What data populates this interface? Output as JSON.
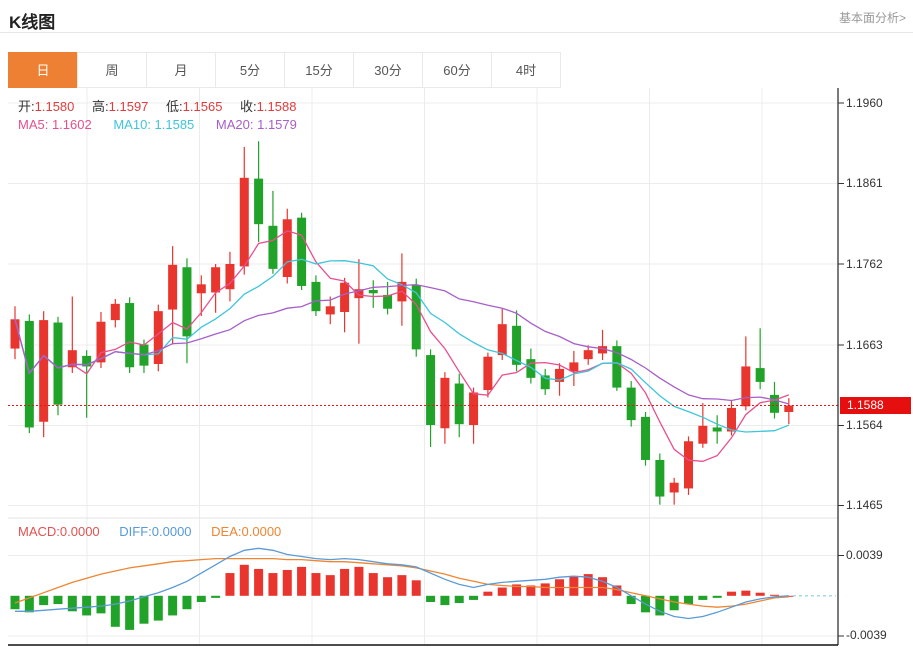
{
  "header": {
    "title": "K线图",
    "link": "基本面分析>"
  },
  "tabs": [
    {
      "label": "日",
      "active": true
    },
    {
      "label": "周",
      "active": false
    },
    {
      "label": "月",
      "active": false
    },
    {
      "label": "5分",
      "active": false
    },
    {
      "label": "15分",
      "active": false
    },
    {
      "label": "30分",
      "active": false
    },
    {
      "label": "60分",
      "active": false
    },
    {
      "label": "4时",
      "active": false
    }
  ],
  "ohlc_legend": [
    {
      "label": "开:",
      "value": "1.1580"
    },
    {
      "label": "高:",
      "value": "1.1597"
    },
    {
      "label": "低:",
      "value": "1.1565"
    },
    {
      "label": "收:",
      "value": "1.1588"
    }
  ],
  "ma_legend": {
    "ma5": "MA5: 1.1602",
    "ma10": "MA10: 1.1585",
    "ma20": "MA20: 1.1579"
  },
  "macd_legend": {
    "macd": "MACD:0.0000",
    "diff": "DIFF:0.0000",
    "dea": "DEA:0.0000"
  },
  "price_tag": "1.1588",
  "colors": {
    "up": "#e8352e",
    "down": "#21a32a",
    "ma5": "#e84f8f",
    "ma10": "#3fc5da",
    "ma20": "#a75fc9",
    "diff": "#5b9bd5",
    "dea": "#ef8532",
    "price_line": "#e81717",
    "tag_bg": "#e50f0f",
    "tab_active": "#ee8033",
    "zero_dash": "#85cfe0",
    "grid": "#ececec",
    "axis": "#333333"
  },
  "chart_data": {
    "type": "candlestick",
    "period": "日",
    "main_ylabels": [
      "1.1960",
      "1.1861",
      "1.1762",
      "1.1663",
      "1.1564",
      "1.1465"
    ],
    "macd_ylabels": [
      "0.0039",
      "-0.0039"
    ],
    "y_top": 1.196,
    "y_bottom": 1.1465,
    "current_price": 1.1588,
    "last_ohlc": {
      "open": 1.158,
      "high": 1.1597,
      "low": 1.1565,
      "close": 1.1588
    },
    "ma_values": {
      "MA5": 1.1602,
      "MA10": 1.1585,
      "MA20": 1.1579
    },
    "candles_format": [
      "open",
      "high",
      "low",
      "close"
    ],
    "candles": [
      [
        1.1658,
        1.171,
        1.1645,
        1.1694
      ],
      [
        1.1692,
        1.17,
        1.1554,
        1.1561
      ],
      [
        1.1568,
        1.1704,
        1.1549,
        1.1693
      ],
      [
        1.169,
        1.1697,
        1.1576,
        1.1589
      ],
      [
        1.1635,
        1.1722,
        1.1628,
        1.1656
      ],
      [
        1.1649,
        1.1656,
        1.1573,
        1.1636
      ],
      [
        1.1641,
        1.1703,
        1.1634,
        1.1691
      ],
      [
        1.1693,
        1.1719,
        1.1684,
        1.1713
      ],
      [
        1.1714,
        1.1721,
        1.1628,
        1.1635
      ],
      [
        1.1663,
        1.1669,
        1.1628,
        1.1637
      ],
      [
        1.1639,
        1.1712,
        1.163,
        1.1704
      ],
      [
        1.1706,
        1.1784,
        1.1663,
        1.1761
      ],
      [
        1.1758,
        1.1769,
        1.164,
        1.1673
      ],
      [
        1.1726,
        1.1748,
        1.1698,
        1.1737
      ],
      [
        1.1727,
        1.1762,
        1.1702,
        1.1758
      ],
      [
        1.1731,
        1.1777,
        1.1716,
        1.1762
      ],
      [
        1.1759,
        1.1906,
        1.1749,
        1.1868
      ],
      [
        1.1867,
        1.1913,
        1.1789,
        1.1811
      ],
      [
        1.1809,
        1.1852,
        1.175,
        1.1756
      ],
      [
        1.1746,
        1.183,
        1.1738,
        1.1817
      ],
      [
        1.1819,
        1.1825,
        1.173,
        1.1735
      ],
      [
        1.174,
        1.1748,
        1.1698,
        1.1704
      ],
      [
        1.17,
        1.1722,
        1.1688,
        1.171
      ],
      [
        1.1703,
        1.1745,
        1.1678,
        1.1739
      ],
      [
        1.172,
        1.1768,
        1.1664,
        1.1731
      ],
      [
        1.173,
        1.1742,
        1.1708,
        1.1726
      ],
      [
        1.1724,
        1.174,
        1.17,
        1.1707
      ],
      [
        1.1716,
        1.1775,
        1.1686,
        1.174
      ],
      [
        1.1736,
        1.1744,
        1.1648,
        1.1657
      ],
      [
        1.165,
        1.1657,
        1.1537,
        1.1564
      ],
      [
        1.156,
        1.1629,
        1.1541,
        1.1622
      ],
      [
        1.1615,
        1.1627,
        1.1549,
        1.1565
      ],
      [
        1.1564,
        1.161,
        1.1541,
        1.1604
      ],
      [
        1.1607,
        1.1653,
        1.1598,
        1.1648
      ],
      [
        1.165,
        1.1707,
        1.1644,
        1.1688
      ],
      [
        1.1686,
        1.1705,
        1.163,
        1.1638
      ],
      [
        1.1645,
        1.1658,
        1.1615,
        1.1622
      ],
      [
        1.1625,
        1.1633,
        1.1601,
        1.1608
      ],
      [
        1.1617,
        1.164,
        1.16,
        1.1633
      ],
      [
        1.163,
        1.1655,
        1.1612,
        1.1641
      ],
      [
        1.1645,
        1.1662,
        1.1638,
        1.1656
      ],
      [
        1.1652,
        1.1681,
        1.1644,
        1.1661
      ],
      [
        1.1661,
        1.1668,
        1.1606,
        1.161
      ],
      [
        1.161,
        1.1618,
        1.1562,
        1.157
      ],
      [
        1.1574,
        1.158,
        1.1514,
        1.1521
      ],
      [
        1.1521,
        1.1529,
        1.1466,
        1.1476
      ],
      [
        1.1481,
        1.1499,
        1.1466,
        1.1493
      ],
      [
        1.1486,
        1.155,
        1.1478,
        1.1544
      ],
      [
        1.1541,
        1.1591,
        1.1536,
        1.1563
      ],
      [
        1.1561,
        1.1576,
        1.1541,
        1.1556
      ],
      [
        1.1556,
        1.1594,
        1.1551,
        1.1585
      ],
      [
        1.1587,
        1.1673,
        1.1582,
        1.1636
      ],
      [
        1.1634,
        1.1683,
        1.1608,
        1.1617
      ],
      [
        1.1601,
        1.1617,
        1.1572,
        1.1579
      ],
      [
        1.158,
        1.1597,
        1.1565,
        1.1588
      ]
    ],
    "ma_periods": [
      5,
      10,
      20
    ],
    "macd": {
      "unit": 0.0001,
      "zero": 0.0,
      "hist": [
        -13,
        -16,
        -9,
        -8,
        -15,
        -19,
        -17,
        -30,
        -33,
        -27,
        -24,
        -19,
        -13,
        -6,
        -2,
        22,
        30,
        26,
        22,
        25,
        28,
        22,
        20,
        26,
        28,
        22,
        18,
        20,
        15,
        -6,
        -9,
        -7,
        -4,
        4,
        8,
        11,
        10,
        12,
        16,
        19,
        21,
        18,
        10,
        -8,
        -16,
        -19,
        -14,
        -8,
        -4,
        -2,
        4,
        5,
        3,
        1,
        0
      ],
      "dif": [
        -15,
        -15,
        -14,
        -13,
        -12,
        -11,
        -10,
        -8,
        -5,
        -1,
        3,
        8,
        14,
        22,
        30,
        38,
        44,
        46,
        44,
        40,
        38,
        36,
        35,
        36,
        35,
        33,
        31,
        30,
        28,
        22,
        16,
        11,
        8,
        11,
        13,
        14,
        15,
        16,
        18,
        19,
        18,
        14,
        8,
        0,
        -8,
        -15,
        -20,
        -22,
        -20,
        -16,
        -11,
        -6,
        -3,
        -1,
        0
      ],
      "dea": [
        -7,
        -2,
        3,
        8,
        13,
        17,
        21,
        24,
        27,
        29,
        31,
        33,
        34,
        35,
        36,
        36,
        36,
        36,
        36,
        35,
        35,
        34,
        33,
        33,
        32,
        31,
        30,
        29,
        27,
        24,
        21,
        17,
        14,
        11,
        10,
        9,
        9,
        8,
        8,
        8,
        8,
        8,
        6,
        3,
        0,
        -3,
        -6,
        -8,
        -10,
        -11,
        -10,
        -8,
        -5,
        -2,
        -1
      ]
    }
  }
}
